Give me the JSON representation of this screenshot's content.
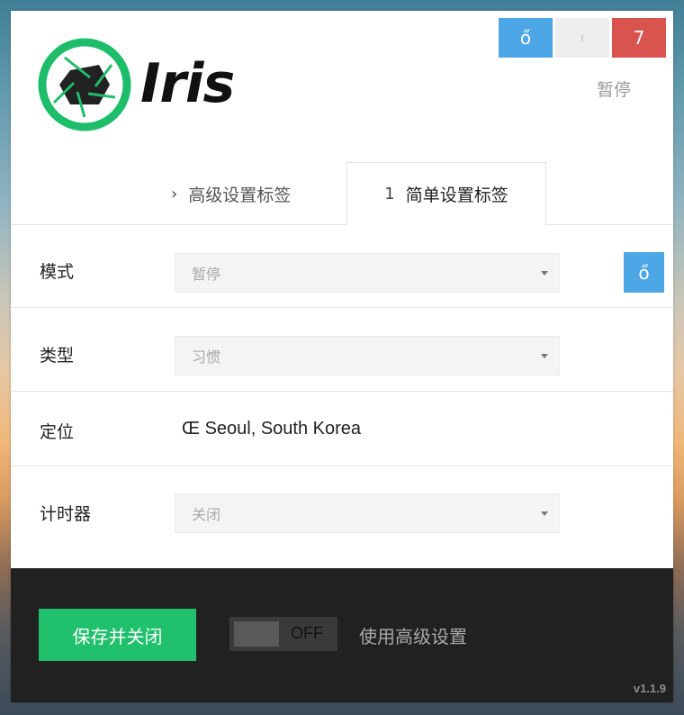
{
  "app": {
    "name": "Iris",
    "version": "v1.1.9"
  },
  "title_bar": {
    "info_button": "ő",
    "minimize_button": "ı",
    "close_button": "7",
    "status": "暂停"
  },
  "tabs": [
    {
      "icon": "›",
      "label": "高级设置标签"
    },
    {
      "icon": "1",
      "label": "简单设置标签"
    }
  ],
  "rows": {
    "mode": {
      "label": "模式",
      "value": "暂停",
      "side_button": "ő"
    },
    "type": {
      "label": "类型",
      "value": "习惯"
    },
    "location": {
      "label": "定位",
      "icon": "Œ",
      "value": "Seoul, South Korea"
    },
    "timer": {
      "label": "计时器",
      "value": "关闭"
    }
  },
  "footer": {
    "save_label": "保存并关闭",
    "toggle_state": "OFF",
    "advanced_label": "使用高级设置"
  },
  "colors": {
    "accent_blue": "#4da6e6",
    "close_red": "#d9534f",
    "save_green": "#20c06c",
    "footer_bg": "#212121",
    "logo_green": "#1dbd6a"
  }
}
